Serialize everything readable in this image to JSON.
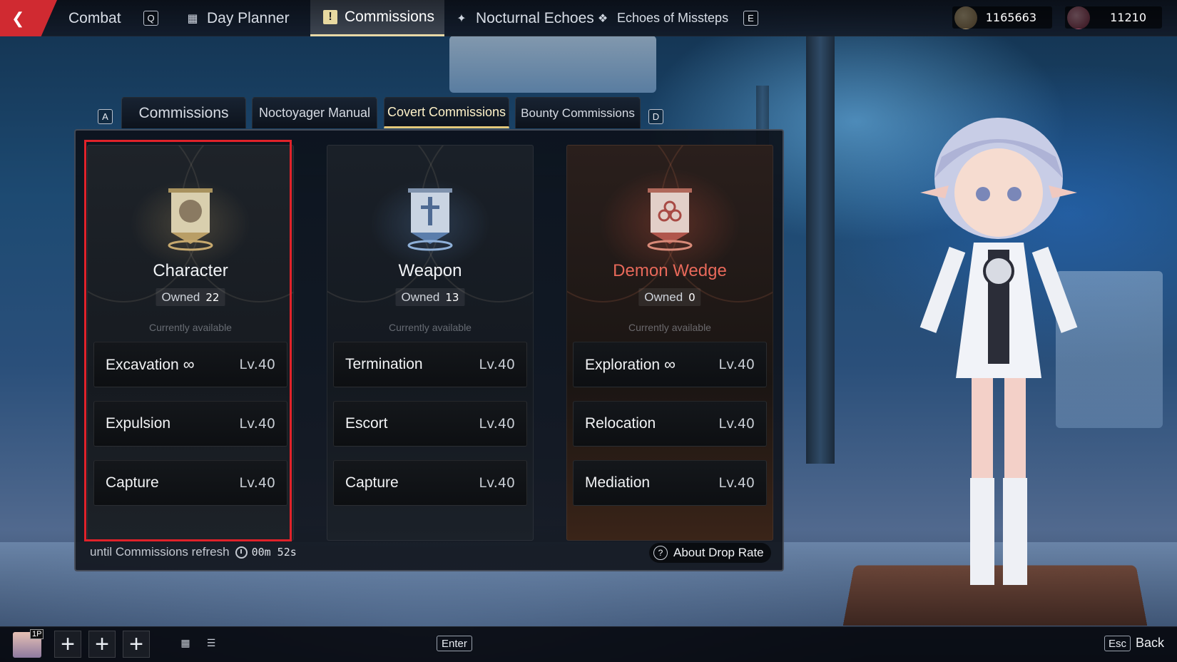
{
  "topbar": {
    "items": [
      {
        "label": "Combat",
        "icon": "combat-icon"
      },
      {
        "label": "Day Planner",
        "icon": "planner-icon"
      },
      {
        "label": "Commissions",
        "icon": "exclamation-icon",
        "active": true
      },
      {
        "label": "Nocturnal Echoes",
        "icon": "compass-icon"
      },
      {
        "label": "Echoes of Missteps",
        "icon": "diamond-icon"
      }
    ],
    "key_left": "Q",
    "key_right": "E",
    "currency_1": "1165663",
    "currency_2": "11210"
  },
  "subtabs": {
    "key_left": "A",
    "key_right": "D",
    "items": [
      {
        "label": "Commissions"
      },
      {
        "label": "Noctoyager Manual"
      },
      {
        "label": "Covert Commissions",
        "active": true
      },
      {
        "label": "Bounty Commissions"
      }
    ]
  },
  "cards": [
    {
      "title": "Character",
      "owned_label": "Owned",
      "owned": "22",
      "status": "Currently available",
      "missions": [
        {
          "name": "Excavation",
          "infinite": "∞",
          "level": "Lv.40"
        },
        {
          "name": "Expulsion",
          "level": "Lv.40"
        },
        {
          "name": "Capture",
          "level": "Lv.40"
        }
      ]
    },
    {
      "title": "Weapon",
      "owned_label": "Owned",
      "owned": "13",
      "status": "Currently available",
      "missions": [
        {
          "name": "Termination",
          "level": "Lv.40"
        },
        {
          "name": "Escort",
          "level": "Lv.40"
        },
        {
          "name": "Capture",
          "level": "Lv.40"
        }
      ]
    },
    {
      "title": "Demon Wedge",
      "owned_label": "Owned",
      "owned": "0",
      "status": "Currently available",
      "missions": [
        {
          "name": "Exploration",
          "infinite": "∞",
          "level": "Lv.40"
        },
        {
          "name": "Relocation",
          "level": "Lv.40"
        },
        {
          "name": "Mediation",
          "level": "Lv.40"
        }
      ]
    }
  ],
  "footer": {
    "refresh_text": "until Commissions refresh",
    "timer": "00m 52s",
    "drop_rate_label": "About Drop Rate",
    "drop_rate_icon": "?"
  },
  "bottombar": {
    "player_tag": "1P",
    "plus": "+",
    "enter_key": "Enter",
    "esc_key": "Esc",
    "back_label": "Back"
  },
  "colors": {
    "accent_gold": "#e4c87a",
    "selection_red": "#e0222a",
    "demon_title": "#e8695a",
    "brand_red": "#d02a31"
  }
}
